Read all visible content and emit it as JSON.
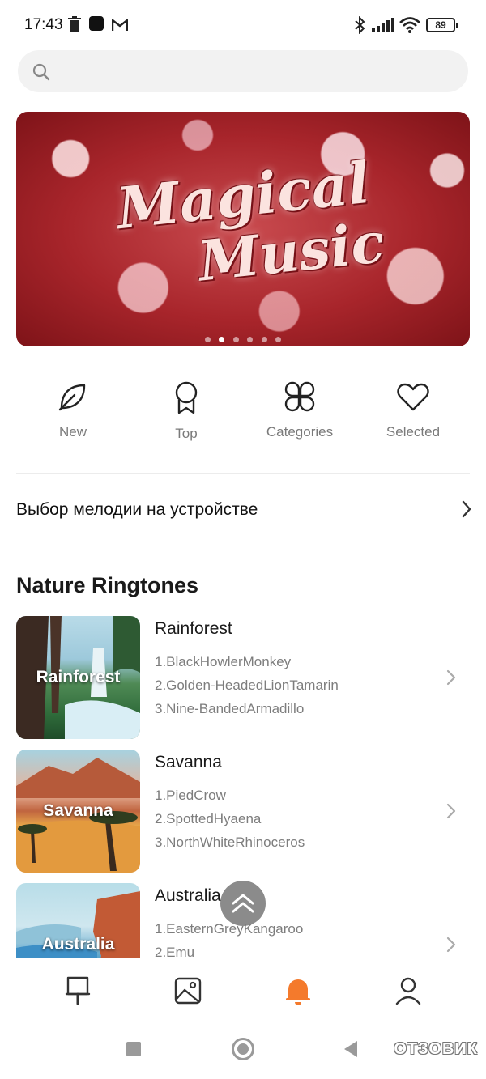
{
  "status_bar": {
    "time": "17:43",
    "battery": "89"
  },
  "search": {
    "placeholder": ""
  },
  "banner": {
    "line1": "Magical",
    "line2": "Music",
    "slides": 6,
    "active_slide": 1
  },
  "quick_nav": [
    {
      "label": "New",
      "icon": "leaf-icon"
    },
    {
      "label": "Top",
      "icon": "award-ribbon-icon"
    },
    {
      "label": "Categories",
      "icon": "clover-grid-icon"
    },
    {
      "label": "Selected",
      "icon": "heart-icon"
    }
  ],
  "device_pick": {
    "label": "Выбор мелодии на устройстве"
  },
  "section": {
    "title": "Nature Ringtones"
  },
  "ringtones": [
    {
      "thumb_label": "Rainforest",
      "name": "Rainforest",
      "tracks": [
        "1.BlackHowlerMonkey",
        "2.Golden-HeadedLionTamarin",
        "3.Nine-BandedArmadillo"
      ]
    },
    {
      "thumb_label": "Savanna",
      "name": "Savanna",
      "tracks": [
        "1.PiedCrow",
        "2.SpottedHyaena",
        "3.NorthWhiteRhinoceros"
      ]
    },
    {
      "thumb_label": "Australia",
      "name": "Australia",
      "tracks": [
        "1.EasternGreyKangaroo",
        "2.Emu"
      ]
    }
  ],
  "tabbar": {
    "tabs": [
      "theme-brush-icon",
      "wallpaper-icon",
      "ringtone-bell-icon",
      "profile-icon"
    ],
    "active": "ringtone-bell-icon"
  },
  "colors": {
    "accent": "#f47a2c",
    "muted_text": "#7a7a7a"
  },
  "watermark": "ОТЗОВИК"
}
